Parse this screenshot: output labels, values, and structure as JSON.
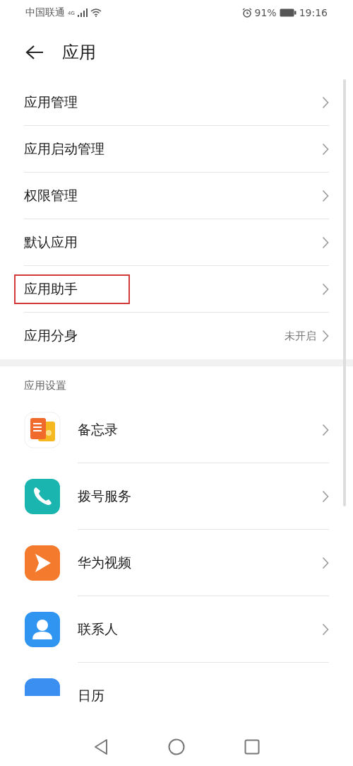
{
  "status_bar": {
    "carrier": "中国联通",
    "network": "4G",
    "battery": "91%",
    "time": "19:16"
  },
  "header": {
    "title": "应用"
  },
  "menu": [
    {
      "label": "应用管理",
      "highlighted": false
    },
    {
      "label": "应用启动管理",
      "highlighted": false
    },
    {
      "label": "权限管理",
      "highlighted": false
    },
    {
      "label": "默认应用",
      "highlighted": false
    },
    {
      "label": "应用助手",
      "highlighted": true
    },
    {
      "label": "应用分身",
      "value": "未开启",
      "highlighted": false
    }
  ],
  "section": {
    "title": "应用设置"
  },
  "apps": [
    {
      "name": "备忘录",
      "kind": "notes"
    },
    {
      "name": "拨号服务",
      "kind": "phone"
    },
    {
      "name": "华为视频",
      "kind": "video"
    },
    {
      "name": "联系人",
      "kind": "contacts"
    },
    {
      "name": "日历",
      "kind": "calendar"
    }
  ]
}
